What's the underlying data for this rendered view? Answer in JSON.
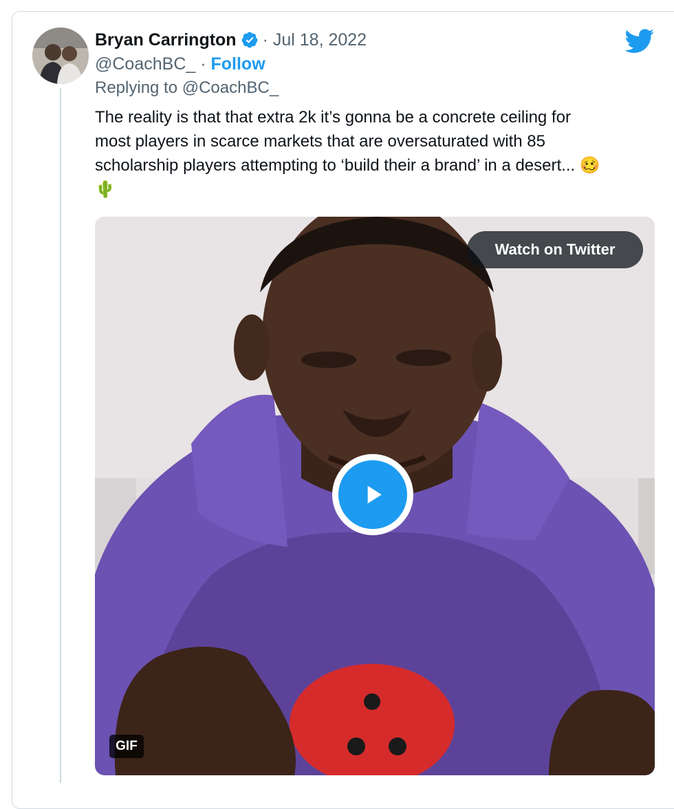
{
  "tweet": {
    "author_name": "Bryan Carrington",
    "date": "· Jul 18, 2022",
    "handle": "@CoachBC_",
    "handle_separator": " · ",
    "follow_label": "Follow",
    "replying_to": "Replying to @CoachBC_",
    "text_lines": [
      "The reality is that that extra 2k it’s gonna be a concrete ceiling for",
      "most players in scarce markets that are oversaturated with 85",
      "scholarship players attempting to ‘build their a brand’ in a desert..."
    ],
    "emoji_face": "🥴",
    "emoji_cactus": "🌵"
  },
  "media": {
    "watch_label": "Watch on Twitter",
    "gif_badge": "GIF"
  },
  "icons": {
    "verified": "verified-badge-icon",
    "logo": "twitter-bird-icon",
    "play": "play-icon"
  },
  "colors": {
    "accent": "#1d9bf0",
    "text": "#0f1419",
    "secondary": "#536471",
    "border": "#cfd9de",
    "hoodie": "#6a4fb0"
  }
}
